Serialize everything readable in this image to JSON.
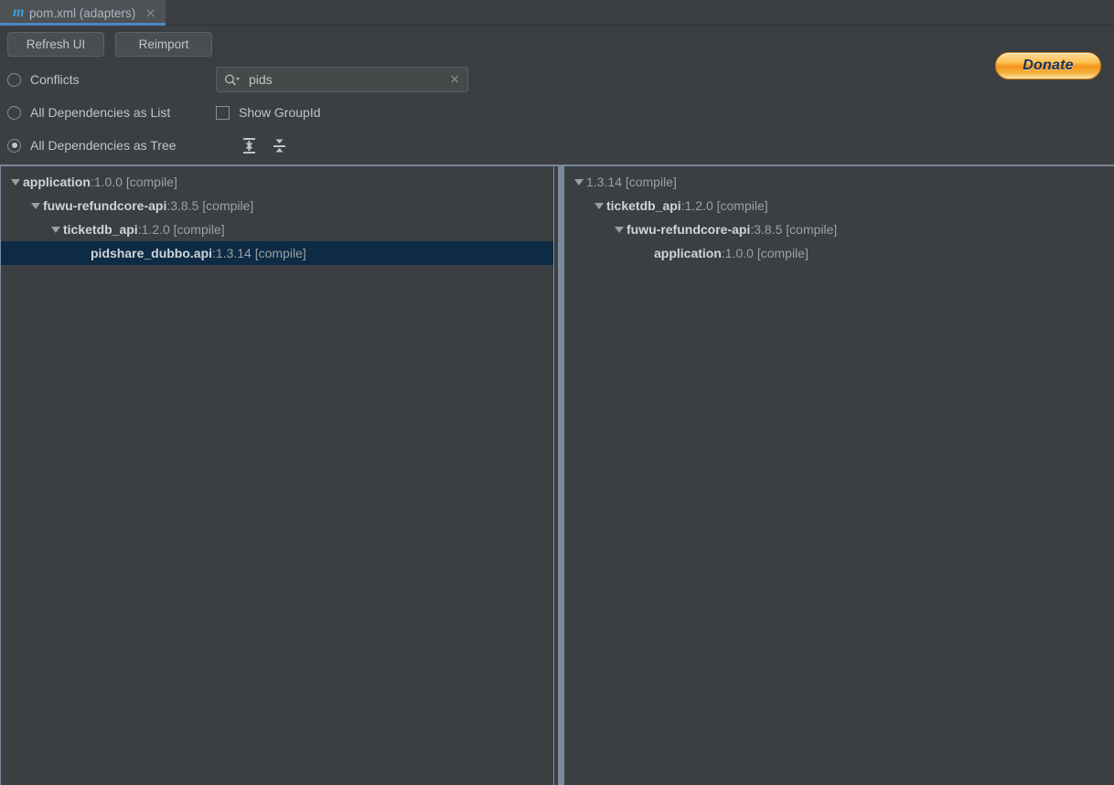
{
  "window": {
    "background_color": "#3c3f41",
    "accent_color": "#4a88c7"
  },
  "tab": {
    "icon": "maven-m-icon",
    "icon_glyph": "m",
    "title": "pom.xml (adapters)",
    "close_glyph": "×"
  },
  "toolbar": {
    "refresh_label": "Refresh UI",
    "reimport_label": "Reimport",
    "donate_label": "Donate",
    "donate_color": "#f3941c"
  },
  "options": {
    "radios": [
      {
        "label": "Conflicts",
        "selected": false
      },
      {
        "label": "All Dependencies as List",
        "selected": false
      },
      {
        "label": "All Dependencies as Tree",
        "selected": true
      }
    ],
    "checkbox": {
      "label": "Show GroupId",
      "checked": false
    },
    "search": {
      "value": "pids",
      "placeholder": "",
      "icon": "search-icon",
      "clear_glyph": "×"
    },
    "tree_tools": [
      {
        "name": "expand-all-icon",
        "tooltip": "Expand All"
      },
      {
        "name": "collapse-all-icon",
        "tooltip": "Collapse All"
      }
    ]
  },
  "left_panel": {
    "rows": [
      {
        "depth": 0,
        "expandable": true,
        "name": "application",
        "sep": " : ",
        "rest": "1.0.0 [compile]",
        "selected": false
      },
      {
        "depth": 1,
        "expandable": true,
        "name": "fuwu-refundcore-api",
        "sep": " : ",
        "rest": "3.8.5 [compile]",
        "selected": false
      },
      {
        "depth": 2,
        "expandable": true,
        "name": "ticketdb_api",
        "sep": " : ",
        "rest": "1.2.0 [compile]",
        "selected": false
      },
      {
        "depth": 3,
        "expandable": false,
        "name": "pidshare_dubbo.api",
        "sep": " : ",
        "rest": "1.3.14 [compile]",
        "selected": true
      }
    ]
  },
  "right_panel": {
    "rows": [
      {
        "depth": 0,
        "expandable": true,
        "name": "",
        "sep": "",
        "rest": "1.3.14 [compile]",
        "selected": false
      },
      {
        "depth": 1,
        "expandable": true,
        "name": "ticketdb_api",
        "sep": " : ",
        "rest": "1.2.0 [compile]",
        "selected": false
      },
      {
        "depth": 2,
        "expandable": true,
        "name": "fuwu-refundcore-api",
        "sep": " : ",
        "rest": "3.8.5 [compile]",
        "selected": false
      },
      {
        "depth": 3,
        "expandable": false,
        "name": "application",
        "sep": " : ",
        "rest": "1.0.0 [compile]",
        "selected": false
      }
    ]
  }
}
